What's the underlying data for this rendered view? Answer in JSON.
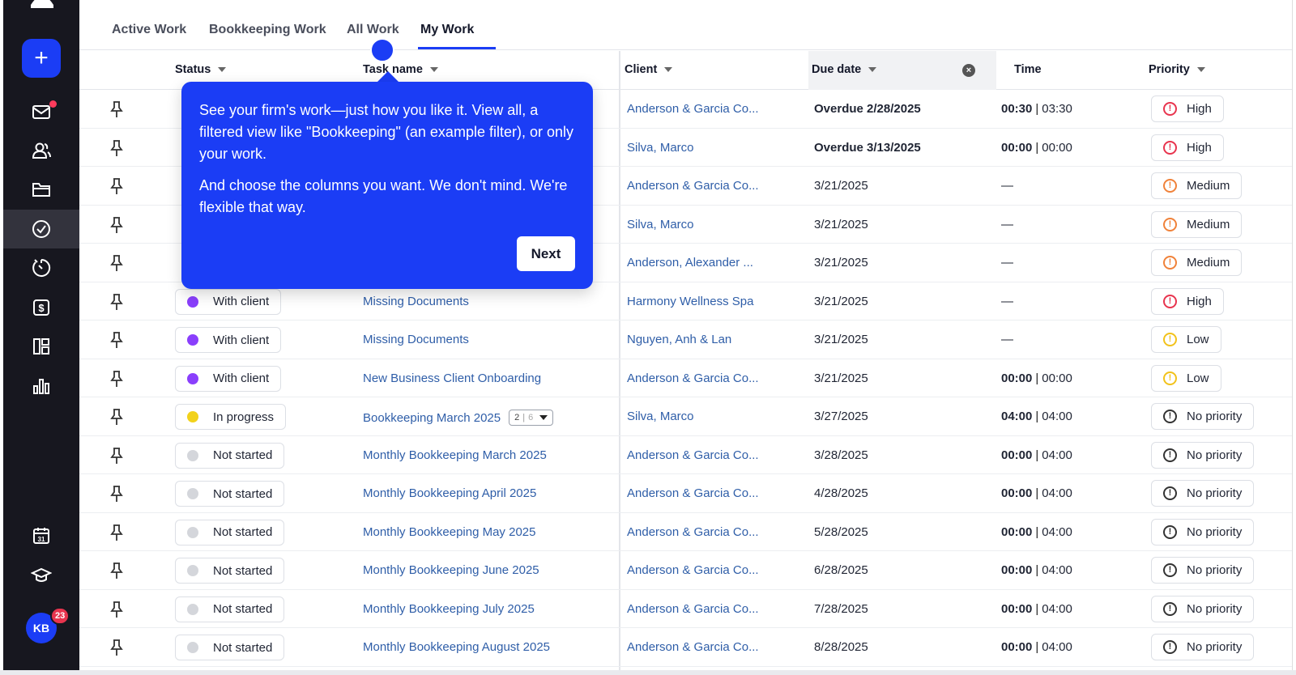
{
  "sidebar": {
    "add_label": "+",
    "avatar_initials": "KB",
    "notification_count": "23"
  },
  "tabs": [
    {
      "label": "Active Work"
    },
    {
      "label": "Bookkeeping Work"
    },
    {
      "label": "All Work"
    },
    {
      "label": "My Work",
      "active": true
    }
  ],
  "columns": {
    "status": "Status",
    "task": "Task name",
    "client": "Client",
    "due": "Due date",
    "time": "Time",
    "priority": "Priority"
  },
  "tooltip": {
    "paragraph1": "See your firm's work—just how you like it. View all, a filtered view like \"Bookkeeping\" (an example filter), or only your work.",
    "paragraph2": "And choose the columns you want. We don't mind. We're flexible that way.",
    "next_label": "Next"
  },
  "status_colors": {
    "With client": "#8a3ffc",
    "In progress": "#f2d21b",
    "Not started": "#d4d6db"
  },
  "priority_colors": {
    "High": "#e8344e",
    "Medium": "#f0823a",
    "Low": "#f2c21b",
    "No priority": "#333333"
  },
  "rows": [
    {
      "status": "",
      "task": "",
      "client": "Anderson & Garcia Co...",
      "due": "Overdue 2/28/2025",
      "overdue": true,
      "time_spent": "00:30",
      "time_budget": "03:30",
      "priority": "High"
    },
    {
      "status": "",
      "task": "",
      "client": "Silva, Marco",
      "due": "Overdue 3/13/2025",
      "overdue": true,
      "time_spent": "00:00",
      "time_budget": "00:00",
      "priority": "High"
    },
    {
      "status": "",
      "task": "",
      "client": "Anderson & Garcia Co...",
      "due": "3/21/2025",
      "time_dash": "—",
      "priority": "Medium"
    },
    {
      "status": "",
      "task": "",
      "client": "Silva, Marco",
      "due": "3/21/2025",
      "time_dash": "—",
      "priority": "Medium"
    },
    {
      "status": "",
      "task": "",
      "client": "Anderson, Alexander ...",
      "due": "3/21/2025",
      "time_dash": "—",
      "priority": "Medium"
    },
    {
      "status": "With client",
      "task": "Missing Documents",
      "client": "Harmony Wellness Spa",
      "due": "3/21/2025",
      "time_dash": "—",
      "priority": "High"
    },
    {
      "status": "With client",
      "task": "Missing Documents",
      "client": "Nguyen, Anh & Lan",
      "due": "3/21/2025",
      "time_dash": "—",
      "priority": "Low"
    },
    {
      "status": "With client",
      "task": "New Business Client Onboarding",
      "client": "Anderson & Garcia Co...",
      "due": "3/21/2025",
      "time_spent": "00:00",
      "time_budget": "00:00",
      "priority": "Low"
    },
    {
      "status": "In progress",
      "task": "Bookkeeping March 2025",
      "subtask_done": "2",
      "subtask_total": "6",
      "client": "Silva, Marco",
      "due": "3/27/2025",
      "time_spent": "04:00",
      "time_budget": "04:00",
      "priority": "No priority"
    },
    {
      "status": "Not started",
      "task": "Monthly Bookkeeping March 2025",
      "client": "Anderson & Garcia Co...",
      "due": "3/28/2025",
      "time_spent": "00:00",
      "time_budget": "04:00",
      "priority": "No priority"
    },
    {
      "status": "Not started",
      "task": "Monthly Bookkeeping April 2025",
      "client": "Anderson & Garcia Co...",
      "due": "4/28/2025",
      "time_spent": "00:00",
      "time_budget": "04:00",
      "priority": "No priority"
    },
    {
      "status": "Not started",
      "task": "Monthly Bookkeeping May 2025",
      "client": "Anderson & Garcia Co...",
      "due": "5/28/2025",
      "time_spent": "00:00",
      "time_budget": "04:00",
      "priority": "No priority"
    },
    {
      "status": "Not started",
      "task": "Monthly Bookkeeping June 2025",
      "client": "Anderson & Garcia Co...",
      "due": "6/28/2025",
      "time_spent": "00:00",
      "time_budget": "04:00",
      "priority": "No priority"
    },
    {
      "status": "Not started",
      "task": "Monthly Bookkeeping July 2025",
      "client": "Anderson & Garcia Co...",
      "due": "7/28/2025",
      "time_spent": "00:00",
      "time_budget": "04:00",
      "priority": "No priority"
    },
    {
      "status": "Not started",
      "task": "Monthly Bookkeeping August 2025",
      "client": "Anderson & Garcia Co...",
      "due": "8/28/2025",
      "time_spent": "00:00",
      "time_budget": "04:00",
      "priority": "No priority"
    }
  ]
}
